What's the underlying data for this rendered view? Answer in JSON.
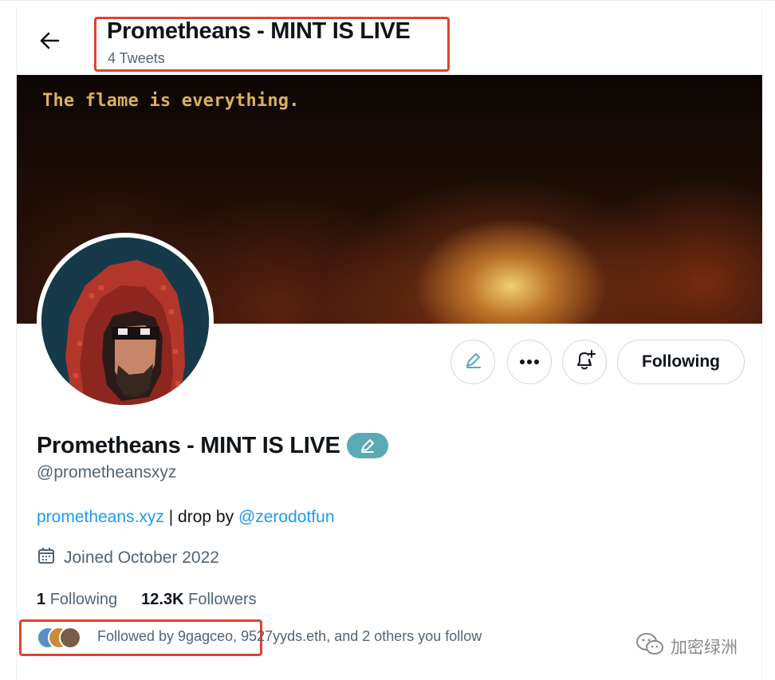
{
  "header": {
    "title": "Prometheans - MINT IS LIVE",
    "tweet_count": "4 Tweets"
  },
  "banner": {
    "tagline": "The flame is everything."
  },
  "actions": {
    "following_label": "Following"
  },
  "profile": {
    "display_name": "Prometheans - MINT IS LIVE",
    "handle": "@prometheansxyz",
    "bio": {
      "link_text": "prometheans.xyz",
      "middle_text": " | drop by ",
      "mention": "@zerodotfun"
    },
    "joined": "Joined October 2022",
    "following_count": "1",
    "following_label": "Following",
    "followers_count": "12.3K",
    "followers_label": "Followers",
    "followed_by": "Followed by 9gagceo, 9527yyds.eth, and 2 others you follow"
  },
  "icons": {
    "back": "arrow-left-icon",
    "edit": "pencil-icon",
    "more": "more-icon",
    "notify": "bell-plus-icon",
    "calendar": "calendar-icon",
    "badge": "pencil-badge-icon"
  },
  "watermark": {
    "text": "加密绿洲"
  },
  "colors": {
    "accent_link": "#1d9bf0",
    "annotation_box": "#e0422f",
    "badge": "#5aaab5",
    "banner_text": "#d9b15e",
    "secondary_text": "#536471"
  }
}
